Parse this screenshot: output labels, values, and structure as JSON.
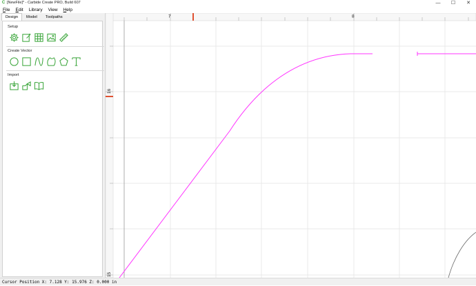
{
  "window": {
    "title": "[NewFile]* - Carbide Create PRO, Build 607",
    "controls": {
      "minimize": "—",
      "maximize": "☐",
      "close": "✕"
    }
  },
  "menu": [
    {
      "label": "File",
      "underline": "F"
    },
    {
      "label": "Edit",
      "underline": "E"
    },
    {
      "label": "Library",
      "underline": ""
    },
    {
      "label": "View",
      "underline": ""
    },
    {
      "label": "Help",
      "underline": "H"
    }
  ],
  "tabs": [
    {
      "label": "Design",
      "active": true
    },
    {
      "label": "Model",
      "active": false
    },
    {
      "label": "Toolpaths",
      "active": false
    }
  ],
  "sections": {
    "setup": {
      "label": "Setup",
      "icons": [
        "gear-icon",
        "edit-job-icon",
        "grid-icon",
        "image-icon",
        "ruler-icon"
      ]
    },
    "create_vector": {
      "label": "Create Vector",
      "icons": [
        "circle-icon",
        "rectangle-icon",
        "curve-icon",
        "polygon-icon",
        "pentagon-icon",
        "text-icon"
      ]
    },
    "import": {
      "label": "Import",
      "icons": [
        "import-icon",
        "import-shape-icon",
        "library-book-icon"
      ]
    }
  },
  "accent_color": "#3aa53a",
  "ruler": {
    "top_labels": [
      "7",
      "8"
    ],
    "left_labels": [
      "16",
      "15"
    ],
    "marker_color": "#e05030"
  },
  "curve_color": "#ff33ff",
  "status": {
    "text": "Cursor Position X: 7.128 Y: 15.976 Z: 0.000 in"
  }
}
